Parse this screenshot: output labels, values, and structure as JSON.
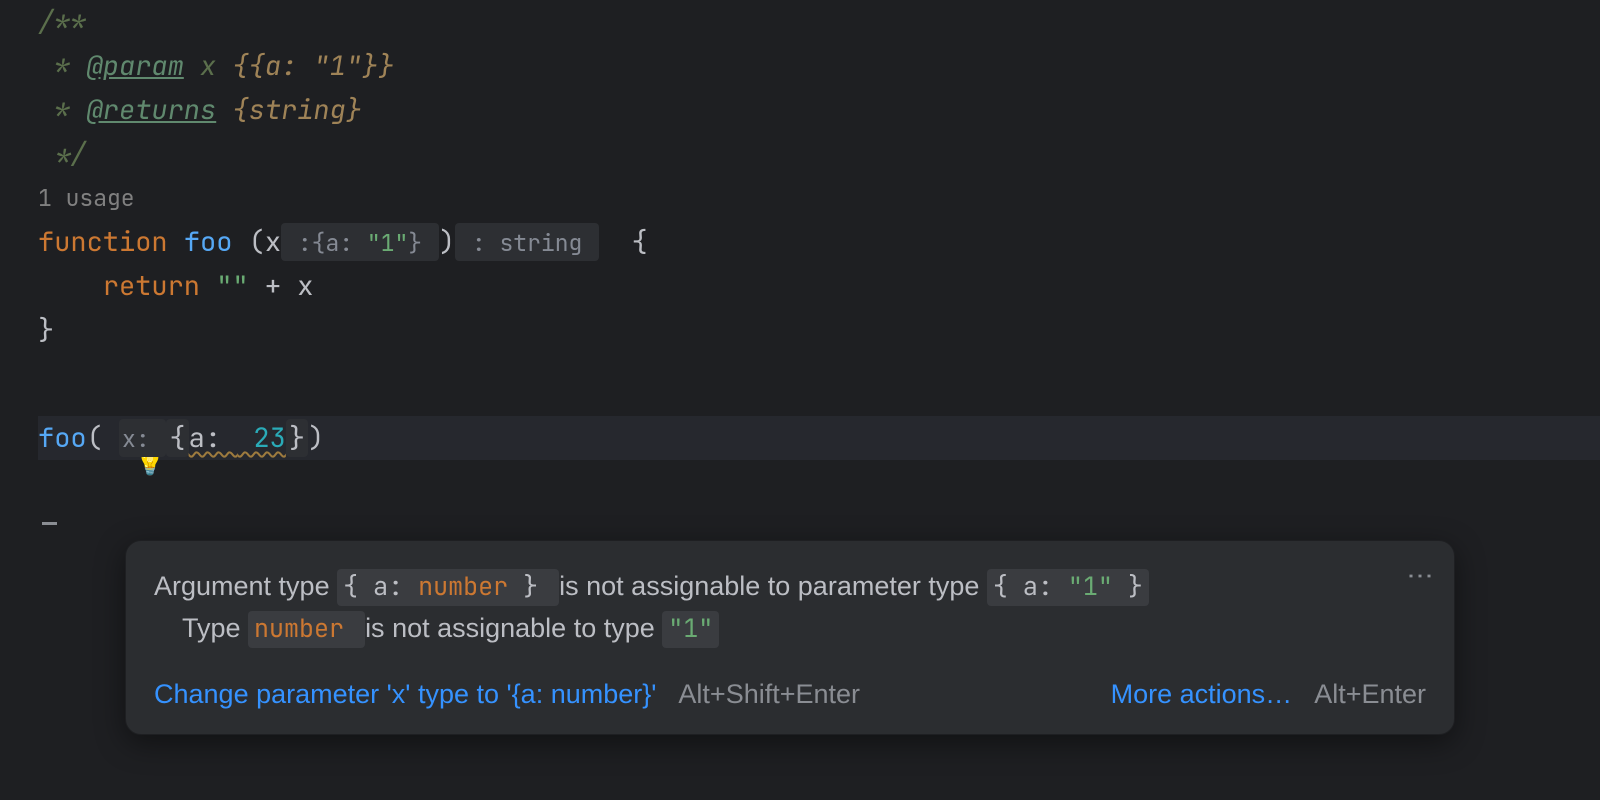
{
  "code": {
    "l1": {
      "text": "/**"
    },
    "l2": {
      "star": " * ",
      "tag": "@param",
      "rest_text": " x ",
      "rest_type": "{{a: \"1\"}}"
    },
    "l3": {
      "star": " * ",
      "tag": "@returns",
      "rest_text": " ",
      "rest_type": "{string}"
    },
    "l4": {
      "text": " */"
    },
    "l5": {
      "hint": "1 usage"
    },
    "l6": {
      "kw": "function",
      "sp1": " ",
      "fname": "foo",
      "sp2": " ",
      "lparen": "(",
      "arg": "x",
      "inlay_pre": " :",
      "inlay_brace_l": "{",
      "inlay_key": "a:",
      "inlay_val": " \"1\"",
      "inlay_brace_r": "}",
      "inlay_post": " ",
      "rparen": ")",
      "ret_inlay": " : string ",
      "sp3": "  ",
      "obrace": "{"
    },
    "l7": {
      "indent": "    ",
      "kw": "return",
      "sp": " ",
      "str": "\"\"",
      "plus": " + ",
      "var": "x"
    },
    "l8": {
      "cbrace": "}"
    },
    "l10": {
      "fname": "foo",
      "lparen": "(",
      "sp1": " ",
      "hint": "x: ",
      "warn_open": "{",
      "warn_key": "a: ",
      "warn_val": " 23",
      "warn_close": "}",
      "rparen": ")"
    }
  },
  "popup": {
    "err1": {
      "p1": "Argument type ",
      "chip1_pre": " { a: ",
      "chip1_mid": "number",
      "chip1_post": " } ",
      "p2": " is not assignable to parameter type ",
      "chip2_pre": " { a: ",
      "chip2_mid": "\"1\"",
      "chip2_post": " } "
    },
    "err2": {
      "p1": "Type ",
      "chip1": " number ",
      "p2": " is not assignable to type ",
      "chip2": " \"1\" "
    },
    "actions": {
      "quickfix": "Change parameter 'x' type to '{a: number}'",
      "quickfix_shortcut": "Alt+Shift+Enter",
      "more": "More actions…",
      "more_shortcut": "Alt+Enter"
    }
  }
}
